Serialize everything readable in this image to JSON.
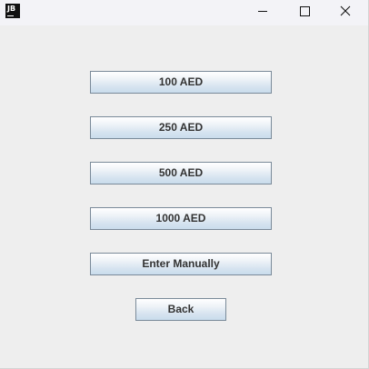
{
  "titlebar": {
    "app_icon_text": "JB",
    "minimize_icon": "minimize-icon",
    "maximize_icon": "maximize-icon",
    "close_icon": "close-icon"
  },
  "buttons": {
    "amount_100": "100 AED",
    "amount_250": "250 AED",
    "amount_500": "500 AED",
    "amount_1000": "1000 AED",
    "enter_manually": "Enter Manually",
    "back": "Back"
  },
  "colors": {
    "window_bg": "#eeeeee",
    "titlebar_bg": "#f3f3f7",
    "button_border": "#7a8a99",
    "button_text": "#333333"
  }
}
